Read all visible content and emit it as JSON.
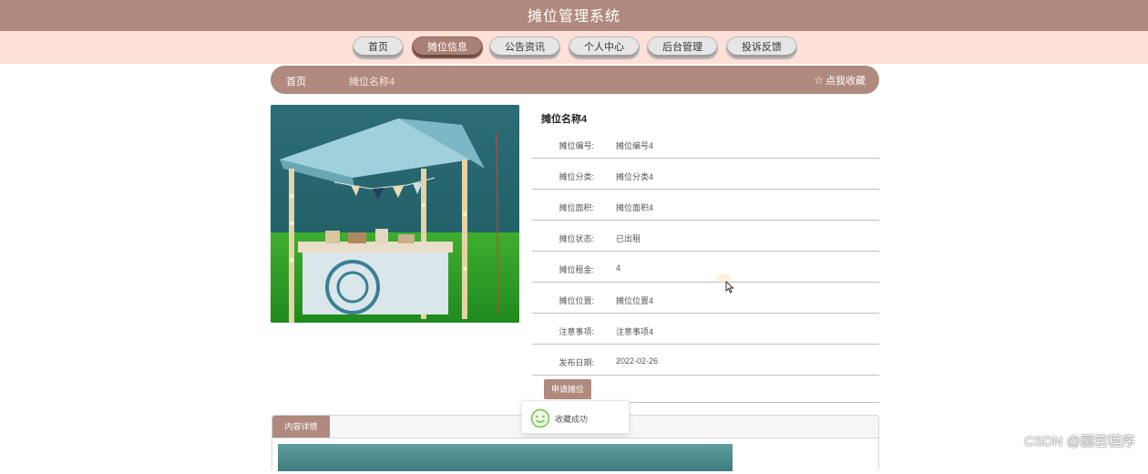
{
  "header": {
    "title": "摊位管理系统"
  },
  "nav": {
    "items": [
      {
        "label": "首页",
        "active": false
      },
      {
        "label": "摊位信息",
        "active": true
      },
      {
        "label": "公告资讯",
        "active": false
      },
      {
        "label": "个人中心",
        "active": false
      },
      {
        "label": "后台管理",
        "active": false
      },
      {
        "label": "投诉反馈",
        "active": false
      }
    ]
  },
  "breadcrumb": {
    "home": "首页",
    "current": "摊位名称4",
    "favorite_label": "点我收藏",
    "favorite_icon": "star-icon"
  },
  "detail": {
    "name": "摊位名称4",
    "fields": [
      {
        "label": "摊位编号:",
        "value": "摊位编号4"
      },
      {
        "label": "摊位分类:",
        "value": "摊位分类4"
      },
      {
        "label": "摊位面积:",
        "value": "摊位面积4"
      },
      {
        "label": "摊位状态:",
        "value": "已出租"
      },
      {
        "label": "摊位租金:",
        "value": "4"
      },
      {
        "label": "摊位位置:",
        "value": "摊位位置4"
      },
      {
        "label": "注意事项:",
        "value": "注意事项4"
      },
      {
        "label": "发布日期:",
        "value": "2022-02-26"
      }
    ],
    "apply_label": "申请摊位"
  },
  "content_tab": {
    "label": "内容详情"
  },
  "toast": {
    "message": "收藏成功",
    "icon": "smile-icon"
  },
  "watermark": "CSDN @圆若程序",
  "colors": {
    "brand": "#b08a7e",
    "nav_bg": "#fde0d8",
    "active_nav": "#a88074"
  }
}
